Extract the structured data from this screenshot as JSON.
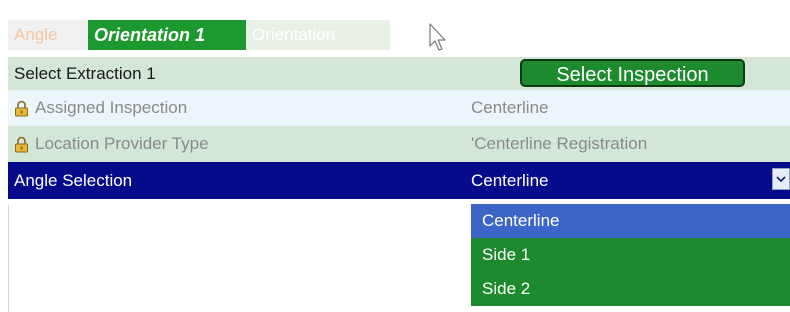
{
  "tabs": [
    {
      "label": "Angle",
      "active": false
    },
    {
      "label": "Orientation 1",
      "active": true
    },
    {
      "label": "Orientation",
      "active": false
    }
  ],
  "header": {
    "title": "Select Extraction 1",
    "button_label": "Select Inspection"
  },
  "rows": [
    {
      "label": "Assigned Inspection",
      "value": "Centerline",
      "locked": true
    },
    {
      "label": "Location Provider Type",
      "value": "'Centerline Registration",
      "locked": true
    },
    {
      "label": "Angle Selection",
      "value": "Centerline",
      "locked": false
    }
  ],
  "dropdown": {
    "options": [
      "Centerline",
      "Side 1",
      "Side 2"
    ],
    "highlighted": "Centerline"
  },
  "colors": {
    "selection_row": "#050b8a",
    "tab_active": "#1c9a30",
    "dropdown_bg": "#1d8a2d",
    "dropdown_highlight": "#3b66c8",
    "row_green": "#d4e6d8"
  },
  "icons": [
    "lock-icon",
    "cursor-icon",
    "chevron-down-icon"
  ]
}
